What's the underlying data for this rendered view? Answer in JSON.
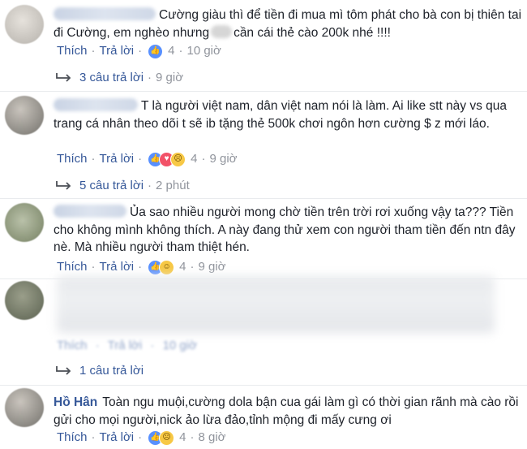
{
  "comments": [
    {
      "text_before": "Cường giàu thì để tiền đi mua mì tôm phát cho bà con bị thiên tai đi Cường, em nghèo nhưng",
      "text_after": "cần cái thẻ cào 200k nhé !!!!",
      "actions": {
        "like": "Thích",
        "reply": "Trả lời",
        "count": "4",
        "time": "10 giờ"
      },
      "reactions": [
        "like"
      ],
      "replies": {
        "label": "3 câu trả lời",
        "time": "9 giờ"
      }
    },
    {
      "text": "T là người việt nam, dân việt nam nói là làm. Ai like stt này vs qua trang cá nhân theo dõi t sẽ ib tặng thẻ 500k chơi ngôn hơn cường $ z mới láo.",
      "actions": {
        "like": "Thích",
        "reply": "Trả lời",
        "count": "4",
        "time": "9 giờ"
      },
      "reactions": [
        "like",
        "love",
        "sad"
      ],
      "replies": {
        "label": "5 câu trả lời",
        "time": "2 phút"
      }
    },
    {
      "text": "Ủa sao nhiều người mong chờ tiền trên trời rơi xuống vậy ta??? Tiền cho không mình không thích. A này đang thử xem con người tham tiền đến ntn đây nè. Mà nhiều người tham thiệt hén.",
      "actions": {
        "like": "Thích",
        "reply": "Trả lời",
        "count": "4",
        "time": "9 giờ"
      },
      "reactions": [
        "like",
        "haha"
      ]
    },
    {
      "actions": {
        "like": "Thích",
        "reply": "Trả lời",
        "time": "10 giờ"
      },
      "replies": {
        "label": "1 câu trả lời"
      }
    },
    {
      "name": "Hồ Hân",
      "text": "Toàn ngu muội,cường dola bận cua gái làm gì có thời gian rãnh mà cào rồi gửi cho mọi người,nick ảo lừa đảo,tỉnh mộng đi mấy cưng ơi",
      "actions": {
        "like": "Thích",
        "reply": "Trả lời",
        "count": "4",
        "time": "8 giờ"
      },
      "reactions": [
        "like",
        "sad"
      ]
    }
  ],
  "colors": {
    "link": "#365899",
    "muted": "#90949c",
    "like": "#5890ff",
    "love": "#f25268",
    "haha": "#f7c845"
  }
}
